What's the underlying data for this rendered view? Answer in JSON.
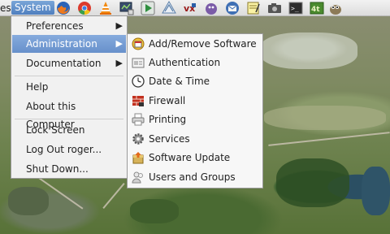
{
  "panel": {
    "places_fragment": "es",
    "system_label": "System",
    "launchers": [
      {
        "icon": "firefox-icon"
      },
      {
        "icon": "chrome-icon"
      },
      {
        "icon": "vlc-icon"
      },
      {
        "icon": "system-monitor-icon"
      },
      {
        "icon": "media-player-icon"
      },
      {
        "icon": "inkscape-icon"
      },
      {
        "icon": "wine-icon"
      },
      {
        "icon": "pidgin-icon"
      },
      {
        "icon": "thunderbird-icon"
      },
      {
        "icon": "notes-icon"
      },
      {
        "icon": "camera-icon"
      },
      {
        "icon": "terminal-icon"
      },
      {
        "icon": "gimp-icon"
      }
    ]
  },
  "main_menu": {
    "items": [
      {
        "label": "Preferences",
        "submenu": true
      },
      {
        "label": "Administration",
        "submenu": true,
        "active": true
      },
      {
        "label": "Documentation",
        "submenu": true
      },
      {
        "label": "Help"
      },
      {
        "label": "About this Computer"
      },
      {
        "label": "Lock Screen"
      },
      {
        "label": "Log Out roger..."
      },
      {
        "label": "Shut Down..."
      }
    ]
  },
  "sub_menu": {
    "items": [
      {
        "label": "Add/Remove Software",
        "icon": "add-remove-software-icon"
      },
      {
        "label": "Authentication",
        "icon": "authentication-icon"
      },
      {
        "label": "Date & Time",
        "icon": "clock-icon"
      },
      {
        "label": "Firewall",
        "icon": "firewall-icon"
      },
      {
        "label": "Printing",
        "icon": "printer-icon"
      },
      {
        "label": "Services",
        "icon": "gear-icon"
      },
      {
        "label": "Software Update",
        "icon": "software-update-icon"
      },
      {
        "label": "Users and Groups",
        "icon": "users-icon"
      }
    ]
  },
  "colors": {
    "menu_highlight": "#6f97d1",
    "panel_bg": "#e6e6e6"
  }
}
